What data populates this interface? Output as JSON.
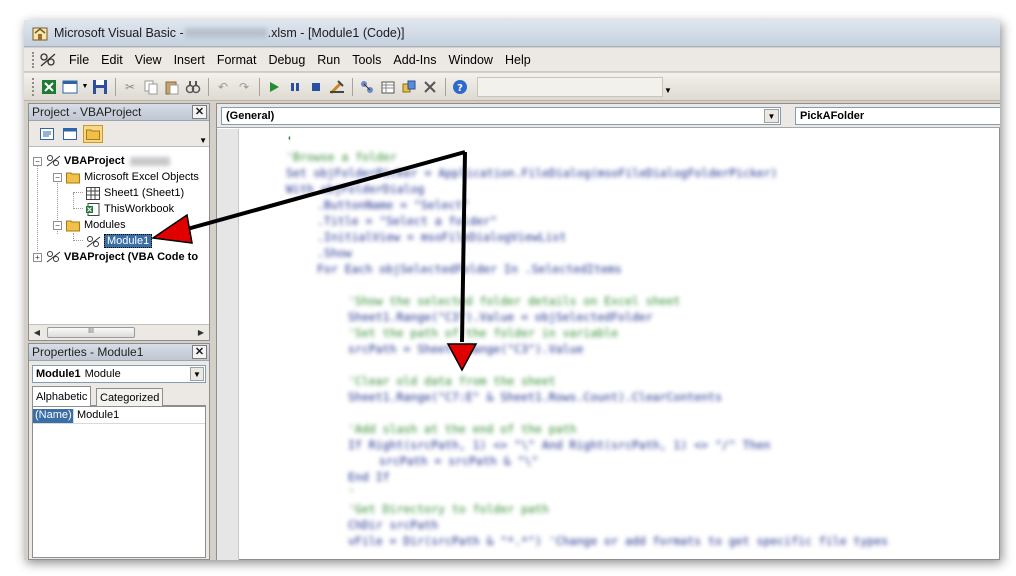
{
  "window": {
    "title_prefix": "Microsoft Visual Basic - ",
    "title_suffix": ".xlsm - [Module1 (Code)]"
  },
  "menu": {
    "items": [
      "File",
      "Edit",
      "View",
      "Insert",
      "Format",
      "Debug",
      "Run",
      "Tools",
      "Add-Ins",
      "Window",
      "Help"
    ]
  },
  "project_pane": {
    "title": "Project - VBAProject",
    "close_glyph": "✕",
    "tree": {
      "root1": "VBAProject",
      "excel_objects": "Microsoft Excel Objects",
      "sheet1": "Sheet1 (Sheet1)",
      "thisworkbook": "ThisWorkbook",
      "modules": "Modules",
      "module1": "Module1",
      "root2": "VBAProject (VBA Code to"
    },
    "scroll_thumb_glyph": "III"
  },
  "properties_pane": {
    "title": "Properties - Module1",
    "close_glyph": "✕",
    "object_name": "Module1",
    "object_type": "Module",
    "tabs": [
      "Alphabetic",
      "Categorized"
    ],
    "property_name": "(Name)",
    "property_value": "Module1"
  },
  "code_window": {
    "object_dropdown": "(General)",
    "procedure_dropdown": "PickAFolder",
    "top_line": "'",
    "lines": [
      {
        "t": "'Browse a folder",
        "c": "cm",
        "indent": 0
      },
      {
        "t": "Set objFolderPicker = Application.FileDialog(msoFileDialogFolderPicker)",
        "c": "tx",
        "indent": 0
      },
      {
        "t": "With objFolderDialog",
        "c": "tx",
        "indent": 0
      },
      {
        "t": ".ButtonName = \"Select\"",
        "c": "tx",
        "indent": 1
      },
      {
        "t": ".Title = \"Select a folder\"",
        "c": "tx",
        "indent": 1
      },
      {
        "t": ".InitialView = msoFileDialogViewList",
        "c": "tx",
        "indent": 1
      },
      {
        "t": ".Show",
        "c": "tx",
        "indent": 1
      },
      {
        "t": "For Each objSelectedFolder In .SelectedItems",
        "c": "tx",
        "indent": 1
      },
      {
        "t": "",
        "c": "tx",
        "indent": 0
      },
      {
        "t": "'Show the selected folder details on Excel sheet",
        "c": "cm",
        "indent": 2
      },
      {
        "t": "Sheet1.Range(\"C3\").Value = objSelectedFolder",
        "c": "tx",
        "indent": 2
      },
      {
        "t": "'Set the path of the folder in variable",
        "c": "cm",
        "indent": 2
      },
      {
        "t": "srcPath = Sheet1.Range(\"C3\").Value",
        "c": "tx",
        "indent": 2
      },
      {
        "t": "",
        "c": "tx",
        "indent": 0
      },
      {
        "t": "'Clear old data from the sheet",
        "c": "cm",
        "indent": 2
      },
      {
        "t": "Sheet1.Range(\"C7:E\" & Sheet1.Rows.Count).ClearContents",
        "c": "tx",
        "indent": 2
      },
      {
        "t": "",
        "c": "tx",
        "indent": 0
      },
      {
        "t": "'Add slash at the end of the path",
        "c": "cm",
        "indent": 2
      },
      {
        "t": "If Right(srcPath, 1) <> \"\\\" And Right(srcPath, 1) <> \"/\" Then",
        "c": "tx",
        "indent": 2
      },
      {
        "t": "srcPath = srcPath & \"\\\"",
        "c": "tx",
        "indent": 3
      },
      {
        "t": "End If",
        "c": "tx",
        "indent": 2
      },
      {
        "t": "'",
        "c": "cm",
        "indent": 2
      },
      {
        "t": "'Get Directory to folder path",
        "c": "cm",
        "indent": 2
      },
      {
        "t": "ChDir srcPath",
        "c": "tx",
        "indent": 2
      },
      {
        "t": "vFile = Dir(srcPath & \"*.*\") 'Change or add formats to get specific file types",
        "c": "tx",
        "indent": 2
      }
    ]
  },
  "colors": {
    "selection": "#3a6ea5",
    "arrow": "#e00000",
    "comment": "#2e8b2e",
    "code": "#1d2d8c"
  }
}
